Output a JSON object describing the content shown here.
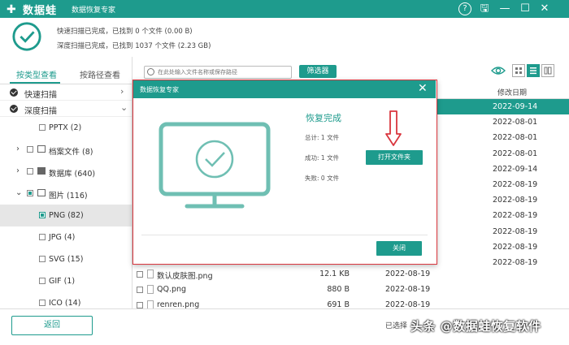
{
  "app": {
    "name": "数据蛙",
    "subtitle": "数据恢复专家",
    "icons": [
      "help-icon",
      "save-icon",
      "minimize-icon",
      "maximize-icon",
      "close-icon"
    ]
  },
  "status": {
    "quick_scan": "快速扫描已完成，已找到 0 个文件 (0.00  B)",
    "deep_scan": "深度扫描已完成，已找到 1037 个文件 (2.23 GB)"
  },
  "left_panel": {
    "tabs": {
      "by_type": "按类型查看",
      "by_path": "按路径查看"
    },
    "scans": {
      "quick": "快速扫描",
      "deep": "深度扫描"
    },
    "tree": [
      {
        "label": "PPTX (2)"
      },
      {
        "label": "档案文件 (8)"
      },
      {
        "label": "数据库 (640)"
      },
      {
        "label": "图片 (116)"
      },
      {
        "label": "PNG (82)"
      },
      {
        "label": "JPG (4)"
      },
      {
        "label": "SVG (15)"
      },
      {
        "label": "GIF (1)"
      },
      {
        "label": "ICO (14)"
      }
    ]
  },
  "toolbar": {
    "search_placeholder": "在此处输入文件名称或保存路径",
    "filter_label": "筛选器"
  },
  "table": {
    "date_header": "修改日期",
    "visible_dates": [
      "2022-09-14",
      "2022-08-01",
      "2022-08-01",
      "2022-08-01",
      "2022-09-14",
      "2022-08-19",
      "2022-08-19",
      "2022-08-19",
      "2022-08-19",
      "2022-08-19",
      "2022-08-19"
    ],
    "rows": [
      {
        "name": "数认皮肤图.png",
        "size": "12.1 KB",
        "date": "2022-08-19"
      },
      {
        "name": "QQ.png",
        "size": "880  B",
        "date": "2022-08-19"
      },
      {
        "name": "renren.png",
        "size": "691  B",
        "date": "2022-08-19"
      }
    ]
  },
  "bottom": {
    "back_label": "返回",
    "selected_info": "已选择",
    "watermark": "头条 @数据蛙恢复软件"
  },
  "dialog": {
    "title": "数据恢复专家",
    "heading": "恢复完成",
    "total": "总计:   1 文件",
    "success": "成功:   1 文件",
    "fail": "失败:   0 文件",
    "open_folder_label": "打开文件夹",
    "close_label": "关闭"
  },
  "colors": {
    "accent": "#1e9b8d",
    "highlight_border": "#d9363e"
  }
}
